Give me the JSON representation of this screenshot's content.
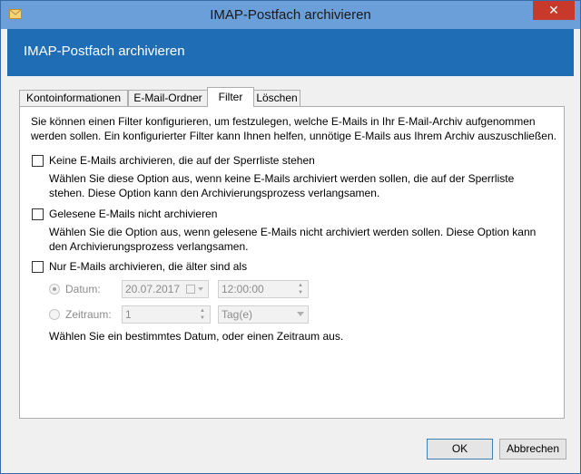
{
  "window": {
    "title": "IMAP-Postfach archivieren",
    "close_symbol": "✕"
  },
  "header": {
    "title": "IMAP-Postfach archivieren"
  },
  "tabs": [
    {
      "label": "Kontoinformationen"
    },
    {
      "label": "E-Mail-Ordner"
    },
    {
      "label": "Filter",
      "active": true
    },
    {
      "label": "Löschen"
    }
  ],
  "panel": {
    "intro_line1": "Sie können einen Filter konfigurieren, um festzulegen, welche E-Mails in Ihr E-Mail-Archiv aufgenommen",
    "intro_line2": "werden sollen. Ein konfigurierter Filter kann Ihnen helfen, unnötige E-Mails aus Ihrem Archiv auszuschließen.",
    "options": [
      {
        "label": "Keine E-Mails archivieren, die auf der Sperrliste stehen",
        "checked": false,
        "desc_line1": "Wählen Sie diese Option aus, wenn keine E-Mails archiviert werden sollen, die auf der Sperrliste",
        "desc_line2": "stehen. Diese Option kann den Archivierungsprozess verlangsamen."
      },
      {
        "label": "Gelesene E-Mails nicht archivieren",
        "checked": false,
        "desc_line1": "Wählen Sie die Option aus, wenn gelesene E-Mails nicht archiviert werden sollen. Diese Option kann",
        "desc_line2": "den Archivierungsprozess verlangsamen."
      },
      {
        "label": "Nur E-Mails archivieren, die älter sind als",
        "checked": false
      }
    ],
    "date_option": {
      "label": "Datum:",
      "date_value": "20.07.2017",
      "time_value": "12:00:00",
      "selected": true
    },
    "period_option": {
      "label": "Zeitraum:",
      "number_value": "1",
      "unit_value": "Tag(e)",
      "selected": false
    },
    "age_hint": "Wählen Sie ein bestimmtes Datum, oder einen Zeitraum aus."
  },
  "buttons": {
    "ok": "OK",
    "cancel": "Abbrechen"
  },
  "colors": {
    "titlebar": "#6b9fd9",
    "header": "#1f6db5",
    "close": "#c7392b"
  }
}
